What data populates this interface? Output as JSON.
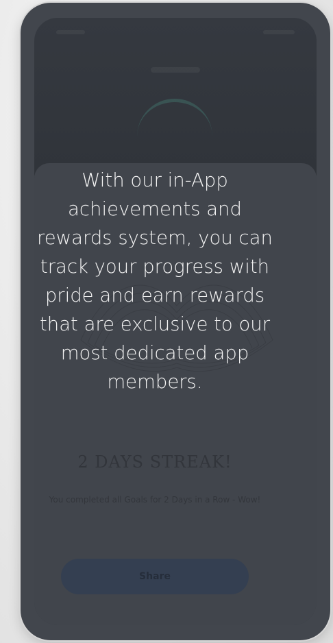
{
  "overlay": {
    "message": "With our in-App achievements and rewards system, you can track your progress with pride and earn rewards that are exclusive to our most dedicated app members."
  },
  "achievement": {
    "title": "2 DAYS STREAK!",
    "subtitle": "You completed all Goals for 2 Days in a Row - Wow!"
  },
  "actions": {
    "share_label": "Share"
  },
  "colors": {
    "overlay_dark": "#42464d",
    "share_button": "#343f51",
    "message_text": "#f3f3f3"
  }
}
